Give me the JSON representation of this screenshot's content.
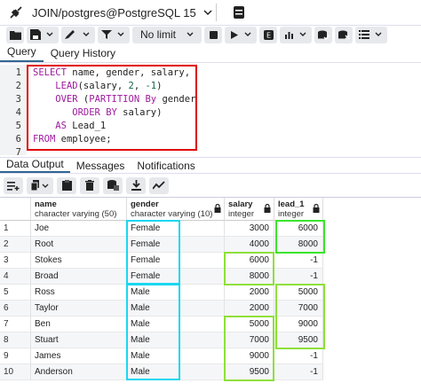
{
  "connection": {
    "label": "JOIN/postgres@PostgreSQL 15"
  },
  "toolbar": {
    "limit": "No limit"
  },
  "tabs_top": [
    {
      "label": "Query"
    },
    {
      "label": "Query History"
    }
  ],
  "editor": {
    "line_numbers": [
      "1",
      "2",
      "3",
      "4",
      "5",
      "6",
      "7"
    ],
    "lines": [
      "SELECT name, gender, salary,",
      "    LEAD(salary, 2, -1)",
      "    OVER (PARTITION By gender",
      "       ORDER BY salary)",
      "    AS Lead_1",
      "FROM employee;",
      ""
    ]
  },
  "tabs_mid": [
    {
      "label": "Data Output"
    },
    {
      "label": "Messages"
    },
    {
      "label": "Notifications"
    }
  ],
  "grid": {
    "columns": [
      {
        "name": "name",
        "type": "character varying (50)"
      },
      {
        "name": "gender",
        "type": "character varying (10)"
      },
      {
        "name": "salary",
        "type": "integer"
      },
      {
        "name": "lead_1",
        "type": "integer"
      }
    ],
    "rows": [
      {
        "n": "1",
        "name": "Joe",
        "gender": "Female",
        "salary": "3000",
        "lead_1": "6000"
      },
      {
        "n": "2",
        "name": "Root",
        "gender": "Female",
        "salary": "4000",
        "lead_1": "8000"
      },
      {
        "n": "3",
        "name": "Stokes",
        "gender": "Female",
        "salary": "6000",
        "lead_1": "-1"
      },
      {
        "n": "4",
        "name": "Broad",
        "gender": "Female",
        "salary": "8000",
        "lead_1": "-1"
      },
      {
        "n": "5",
        "name": "Ross",
        "gender": "Male",
        "salary": "2000",
        "lead_1": "5000"
      },
      {
        "n": "6",
        "name": "Taylor",
        "gender": "Male",
        "salary": "2000",
        "lead_1": "7000"
      },
      {
        "n": "7",
        "name": "Ben",
        "gender": "Male",
        "salary": "5000",
        "lead_1": "9000"
      },
      {
        "n": "8",
        "name": "Stuart",
        "gender": "Male",
        "salary": "7000",
        "lead_1": "9500"
      },
      {
        "n": "9",
        "name": "James",
        "gender": "Male",
        "salary": "9000",
        "lead_1": "-1"
      },
      {
        "n": "10",
        "name": "Anderson",
        "gender": "Male",
        "salary": "9500",
        "lead_1": "-1"
      }
    ]
  },
  "colors": {
    "query_box": "#e00000",
    "gender_box": "#1ad7f0",
    "lead_box": "#39e62c",
    "salary_box": "#8ee03a",
    "active_tab": "#326690"
  }
}
